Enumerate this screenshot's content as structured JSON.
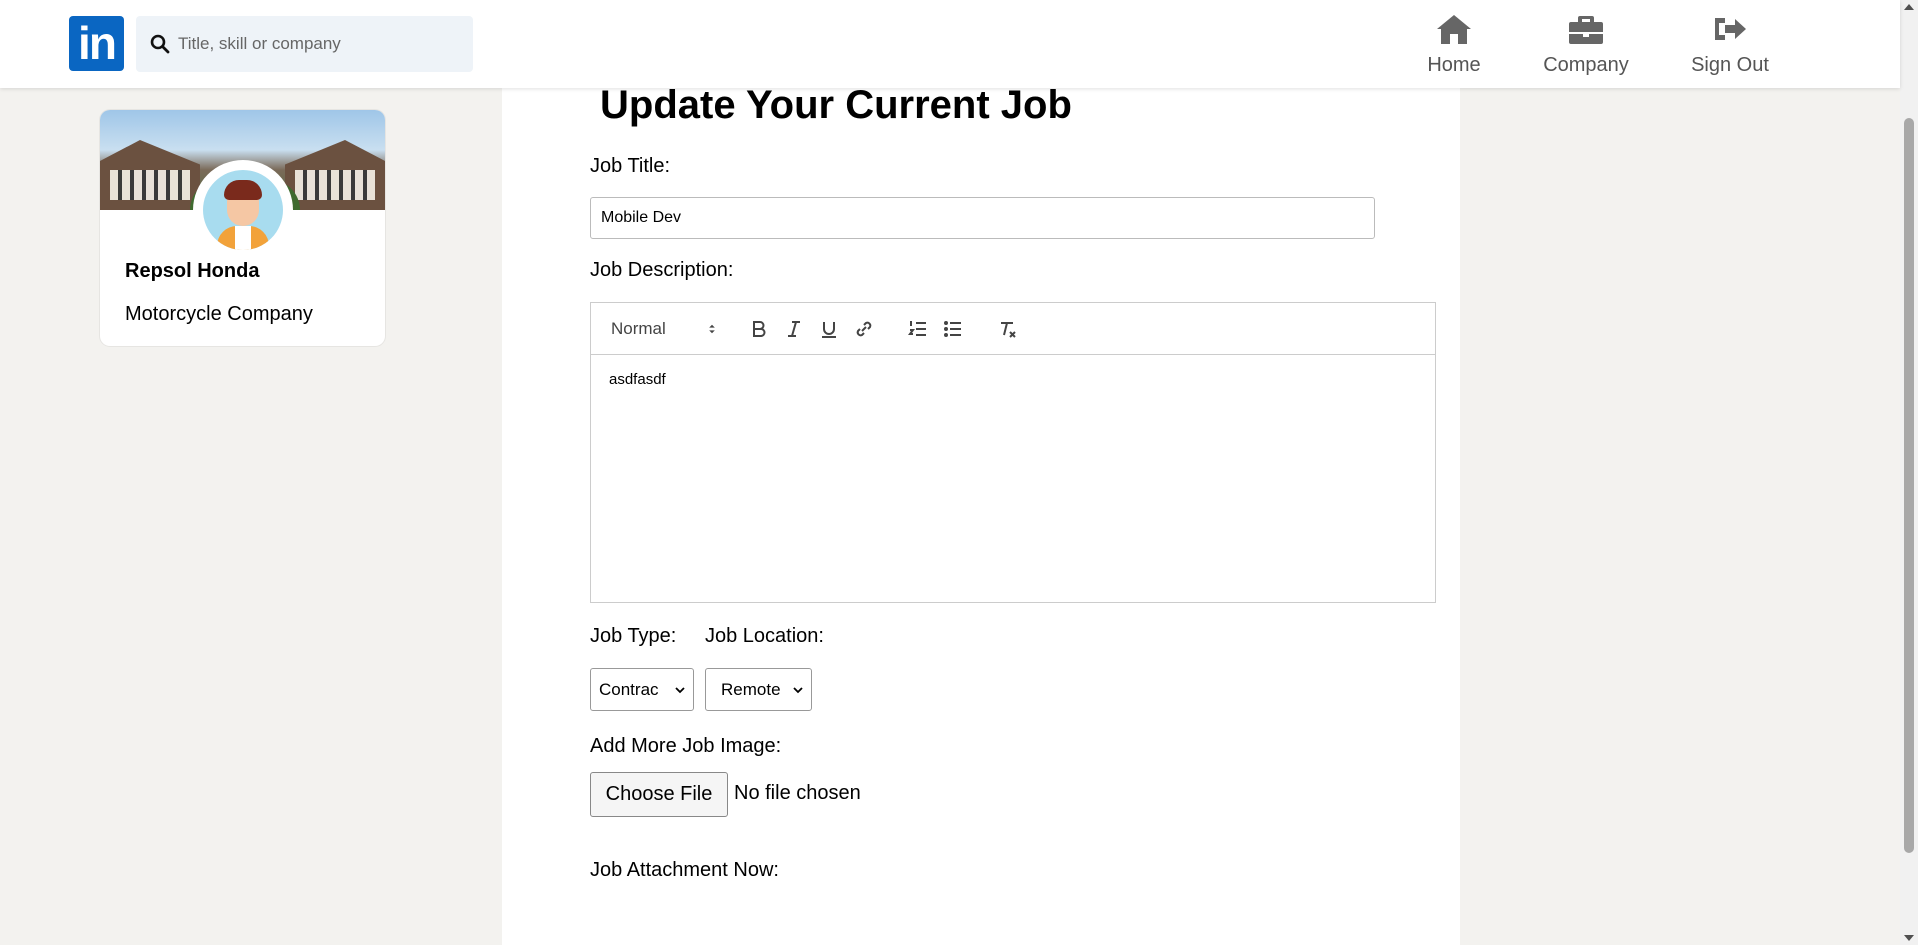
{
  "header": {
    "logo_text": "in",
    "search_placeholder": "Title, skill or company",
    "nav": [
      {
        "label": "Home",
        "icon": "home-icon"
      },
      {
        "label": "Company",
        "icon": "briefcase-icon"
      },
      {
        "label": "Sign Out",
        "icon": "sign-out-icon"
      }
    ]
  },
  "profile": {
    "name": "Repsol Honda",
    "subtitle": "Motorcycle Company"
  },
  "form": {
    "title": "Update Your Current Job",
    "job_title_label": "Job Title:",
    "job_title_value": "Mobile Dev",
    "job_description_label": "Job Description:",
    "editor": {
      "heading_select": "Normal",
      "content": "asdfasdf"
    },
    "job_type_label": "Job Type:",
    "job_type_value": "Contrac",
    "job_location_label": "Job Location:",
    "job_location_value": "Remote",
    "add_image_label": "Add More Job Image:",
    "choose_file_label": "Choose File",
    "file_status": "No file chosen",
    "attachment_label": "Job Attachment Now:"
  },
  "colors": {
    "brand": "#0a66c2",
    "page_bg": "#f3f2ef"
  }
}
